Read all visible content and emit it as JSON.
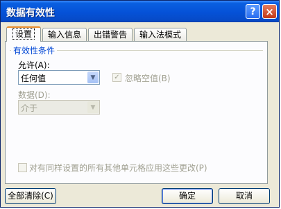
{
  "window": {
    "title": "数据有效性",
    "help_glyph": "?",
    "close_glyph": "×"
  },
  "tabs": [
    {
      "label": "设置"
    },
    {
      "label": "输入信息"
    },
    {
      "label": "出错警告"
    },
    {
      "label": "输入法模式"
    }
  ],
  "settings": {
    "group_title": "有效性条件",
    "allow_label": "允许(A):",
    "allow_value": "任何值",
    "ignore_blank_label": "忽略空值(B)",
    "ignore_blank_checked": true,
    "data_label": "数据(D):",
    "data_value": "介于",
    "apply_all_label": "对有同样设置的所有其他单元格应用这些更改(P)",
    "apply_all_checked": false
  },
  "buttons": {
    "clear_all": "全部清除(C)",
    "ok": "确定",
    "cancel": "取消"
  },
  "icons": {
    "checkmark": "✓",
    "dropdown": "▼"
  }
}
